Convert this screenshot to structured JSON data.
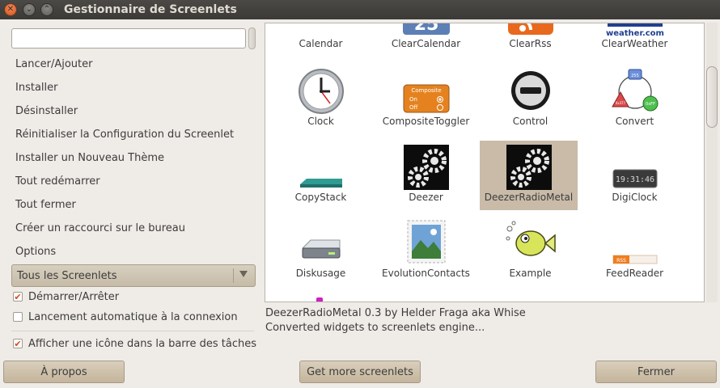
{
  "window": {
    "title": "Gestionnaire de Screenlets"
  },
  "search": {
    "value": "",
    "placeholder": ""
  },
  "actions": [
    "Lancer/Ajouter",
    "Installer",
    "Désinstaller",
    "Réinitialiser la Configuration du Screenlet",
    "Installer un Nouveau Thème",
    "Tout redémarrer",
    "Tout fermer",
    "Créer un raccourci sur le bureau",
    "Options"
  ],
  "filter": {
    "selected": "Tous les Screenlets"
  },
  "checks": [
    {
      "label": "Démarrer/Arrêter",
      "checked": true
    },
    {
      "label": "Lancement automatique à la connexion",
      "checked": false
    },
    {
      "label": "Afficher une icône dans la barre des tâches",
      "checked": true
    }
  ],
  "screenlets": [
    {
      "name": "Calendar",
      "icon": "calendar-icon"
    },
    {
      "name": "ClearCalendar",
      "icon": "clear-calendar-icon"
    },
    {
      "name": "ClearRss",
      "icon": "rss-icon"
    },
    {
      "name": "ClearWeather",
      "icon": "weather-icon"
    },
    {
      "name": "Clock",
      "icon": "clock-icon"
    },
    {
      "name": "CompositeToggler",
      "icon": "composite-toggler-icon"
    },
    {
      "name": "Control",
      "icon": "control-icon"
    },
    {
      "name": "Convert",
      "icon": "convert-icon"
    },
    {
      "name": "CopyStack",
      "icon": "copystack-icon"
    },
    {
      "name": "Deezer",
      "icon": "gears-icon"
    },
    {
      "name": "DeezerRadioMetal",
      "icon": "gears-icon",
      "selected": true
    },
    {
      "name": "DigiClock",
      "icon": "digiclock-icon"
    },
    {
      "name": "Diskusage",
      "icon": "disk-icon"
    },
    {
      "name": "EvolutionContacts",
      "icon": "contacts-stamp-icon"
    },
    {
      "name": "Example",
      "icon": "fish-icon"
    },
    {
      "name": "FeedReader",
      "icon": "feed-reader-icon"
    }
  ],
  "icon_text": {
    "clear_calendar_day": "25",
    "weather_brand": "weather.com",
    "composite_title": "Composite",
    "composite_on": "On",
    "composite_off": "Off",
    "convert_top": "255",
    "convert_left": "0x377",
    "convert_right": "0xFF",
    "digiclock_time": "19:31:46",
    "feed_rss": "RSS"
  },
  "description": {
    "line1": "DeezerRadioMetal 0.3 by Helder Fraga aka Whise",
    "line2": "Converted widgets to screenlets engine..."
  },
  "buttons": {
    "about": "À propos",
    "more": "Get more screenlets",
    "close": "Fermer"
  },
  "colors": {
    "accent_orange": "#d3541a",
    "selection": "#c9bba8"
  }
}
